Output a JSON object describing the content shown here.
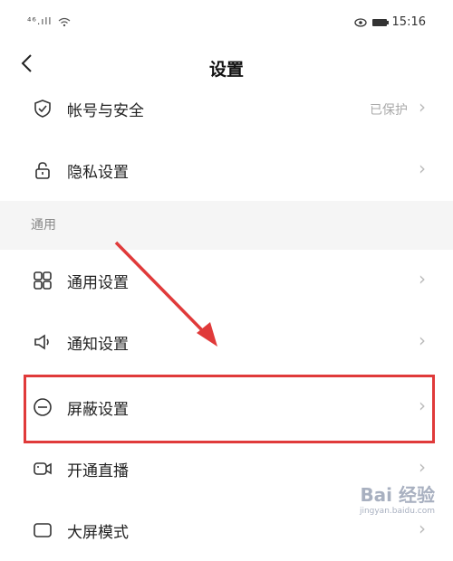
{
  "status_bar": {
    "signal": "⁴⁶.ıll",
    "time": "15:16"
  },
  "nav": {
    "title": "设置"
  },
  "rows_top": [
    {
      "label": "帐号与安全",
      "status": "已保护"
    },
    {
      "label": "隐私设置",
      "status": ""
    }
  ],
  "section_header": "通用",
  "rows_general": [
    {
      "label": "通用设置"
    },
    {
      "label": "通知设置"
    },
    {
      "label": "屏蔽设置"
    },
    {
      "label": "开通直播"
    },
    {
      "label": "大屏模式"
    }
  ],
  "watermark": {
    "main": "Bai 经验",
    "sub": "jingyan.baidu.com"
  },
  "colors": {
    "accent_red": "#e03a3a"
  }
}
